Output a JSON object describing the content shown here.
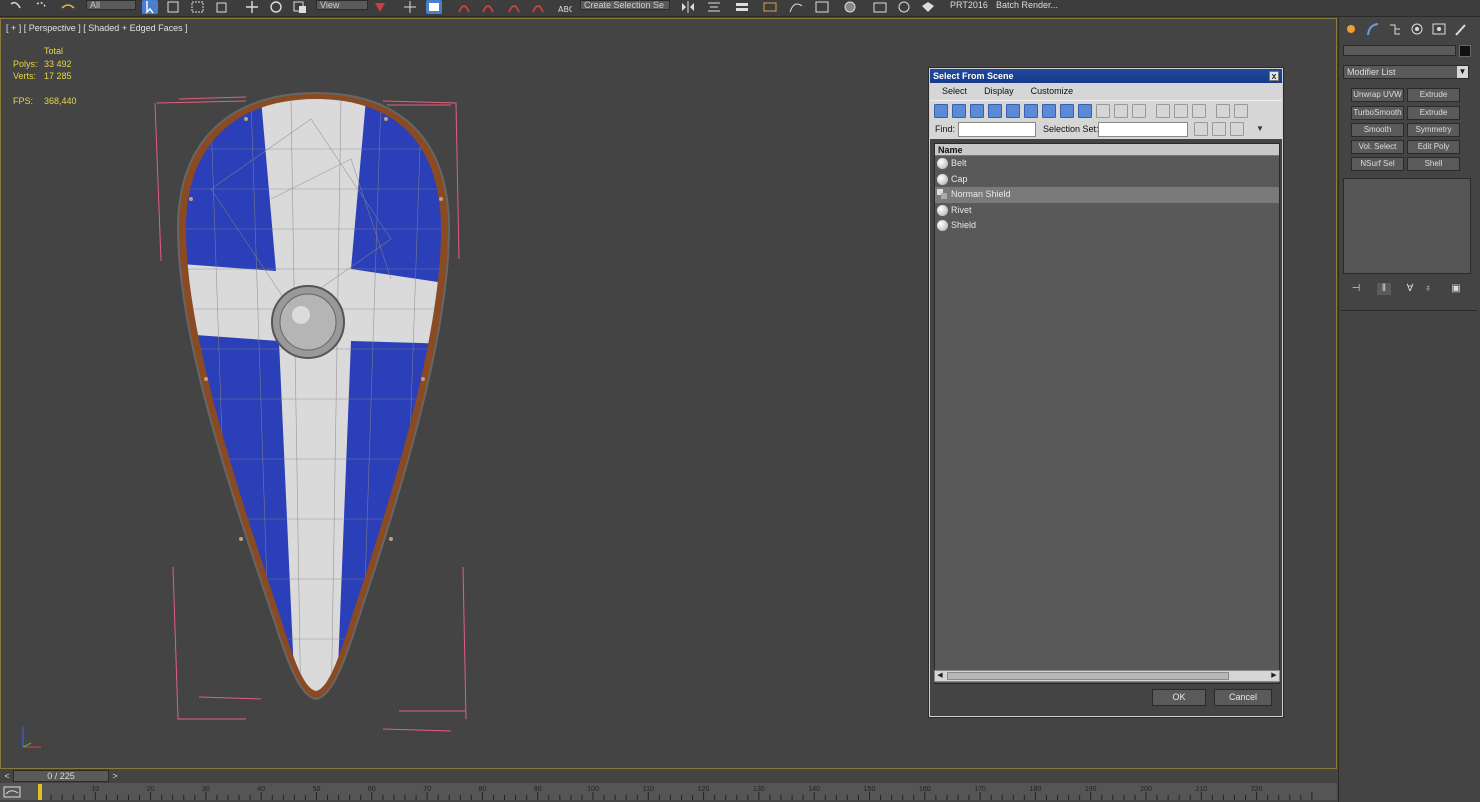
{
  "main_toolbar": {
    "selection_filter": "All",
    "view_dropdown": "View",
    "named_selection_set": "Create Selection Se",
    "project_label": "PRT2016",
    "batch_render_label": "Batch Render..."
  },
  "viewport": {
    "label": "[ + ] [ Perspective ] [ Shaded + Edged Faces ]",
    "stats": {
      "total_label": "Total",
      "polys_label": "Polys:",
      "polys_value": "33 492",
      "verts_label": "Verts:",
      "verts_value": "17 285",
      "fps_label": "FPS:",
      "fps_value": "368,440"
    },
    "colors": {
      "shield_blue": "#2b3fb8",
      "shield_white": "#d9d9d9",
      "rim": "#8a4a22",
      "bbox": "#e06080"
    }
  },
  "dialog": {
    "title": "Select From Scene",
    "close_glyph": "x",
    "menu": [
      "Select",
      "Display",
      "Customize"
    ],
    "find_label": "Find:",
    "selection_set_label": "Selection Set:",
    "column_name": "Name",
    "rows": [
      {
        "label": "Belt",
        "selected": false,
        "icon": "geometry-icon"
      },
      {
        "label": "Cap",
        "selected": false,
        "icon": "geometry-icon"
      },
      {
        "label": "Norman Shield",
        "selected": true,
        "icon": "group-icon"
      },
      {
        "label": "Rivet",
        "selected": false,
        "icon": "geometry-icon"
      },
      {
        "label": "Shield",
        "selected": false,
        "icon": "geometry-icon"
      }
    ],
    "ok_label": "OK",
    "cancel_label": "Cancel"
  },
  "command_panel": {
    "modifier_list": "Modifier List",
    "modifier_buttons": [
      "Unwrap UVW",
      "Extrude",
      "TurboSmooth",
      "Extrude",
      "Smooth",
      "Symmetry",
      "Vol. Select",
      "Edit Poly",
      "NSurf Sel",
      "Shell"
    ]
  },
  "timeline": {
    "frame_display": "0 / 225",
    "prev_glyph": "<",
    "next_glyph": ">",
    "ticks": [
      "10",
      "20",
      "30",
      "40",
      "50",
      "60",
      "70",
      "80",
      "90",
      "100",
      "110",
      "120",
      "130",
      "140",
      "150",
      "160",
      "170",
      "180",
      "190",
      "200",
      "210",
      "220"
    ]
  }
}
